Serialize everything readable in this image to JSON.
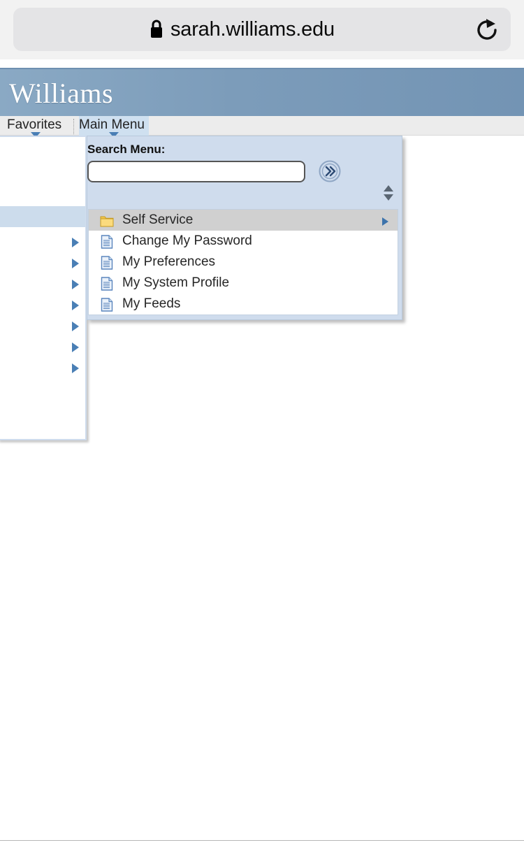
{
  "browser": {
    "url": "sarah.williams.edu",
    "lock_icon": "lock-icon",
    "reload_icon": "reload-icon"
  },
  "banner": {
    "logo_text": "Williams",
    "gradient_from": "#8aa9c4",
    "gradient_to": "#7394b4"
  },
  "tabs": [
    {
      "id": "favorites",
      "label": "Favorites",
      "active": false
    },
    {
      "id": "main-menu",
      "label": "Main Menu",
      "active": true
    }
  ],
  "dropdown": {
    "search_label": "Search Menu:",
    "search_value": "",
    "search_placeholder": "",
    "go_icon": "double-chevron-right-icon",
    "spinner_icon": "up-down-spinner-icon",
    "items": [
      {
        "label": "Self Service",
        "icon": "folder-icon",
        "selected": true,
        "has_submenu": true
      },
      {
        "label": "Change My Password",
        "icon": "document-icon",
        "selected": false,
        "has_submenu": false
      },
      {
        "label": "My Preferences",
        "icon": "document-icon",
        "selected": false,
        "has_submenu": false
      },
      {
        "label": "My System Profile",
        "icon": "document-icon",
        "selected": false,
        "has_submenu": false
      },
      {
        "label": "My Feeds",
        "icon": "document-icon",
        "selected": false,
        "has_submenu": false
      }
    ]
  },
  "left_panel": {
    "arrow_icon": "chevron-right-icon",
    "arrow_count": 7,
    "highlight_color": "#ccdcec"
  },
  "colors": {
    "accent_blue": "#4a7fb5",
    "panel_blue": "#cfdced",
    "selected_gray": "#d0d0d0"
  }
}
